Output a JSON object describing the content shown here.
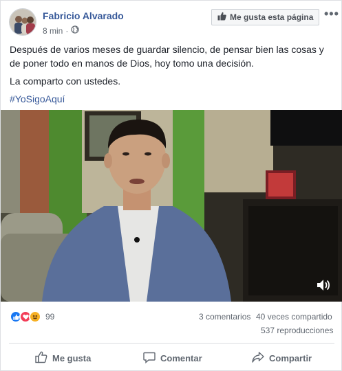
{
  "header": {
    "page_name": "Fabricio Alvarado",
    "timestamp": "8 min",
    "separator": "·",
    "audience_icon": "globe-icon",
    "like_page_label": "Me gusta esta página",
    "more_icon": "more-icon",
    "more_label": "•••"
  },
  "post": {
    "paragraph_1": "Después de varios meses de guardar silencio, de pensar bien las cosas y de poner todo en manos de Dios, hoy tomo una decisión.",
    "paragraph_2": "La comparto con ustedes.",
    "hashtag": "#YoSigoAquí"
  },
  "video": {
    "volume_icon": "speaker-icon"
  },
  "stats": {
    "reaction_icons": [
      "like-reaction-icon",
      "love-reaction-icon",
      "haha-reaction-icon"
    ],
    "reaction_count": "99",
    "comments": "3 comentarios",
    "shares": "40 veces compartido",
    "views": "537 reproducciones"
  },
  "actions": {
    "like_label": "Me gusta",
    "comment_label": "Comentar",
    "share_label": "Compartir"
  },
  "colors": {
    "link_blue": "#365899",
    "like_blue": "#1877f2",
    "love_red": "#f33e58",
    "haha_yellow": "#f7b125",
    "muted_text": "#606770"
  }
}
